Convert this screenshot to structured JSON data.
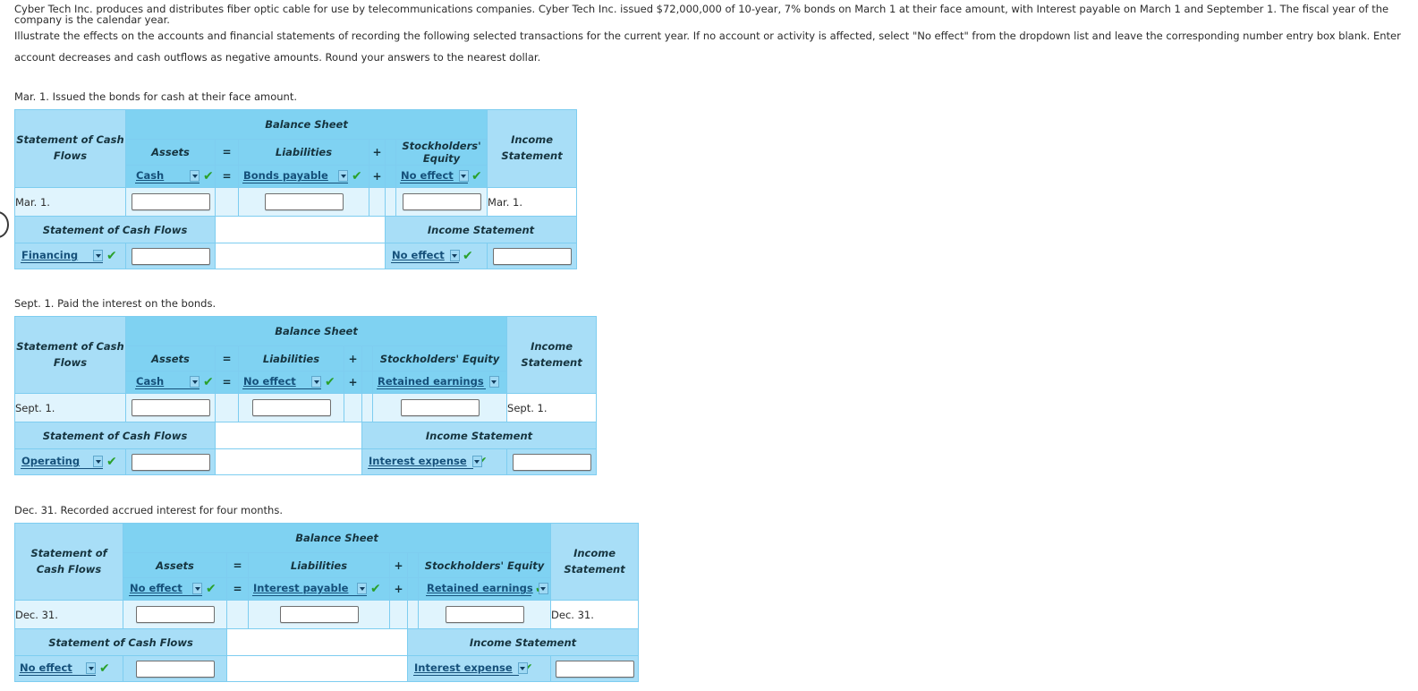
{
  "intro": {
    "paragraph1": "Cyber Tech Inc. produces and distributes fiber optic cable for use by telecommunications companies. Cyber Tech Inc. issued $72,000,000 of 10-year, 7% bonds on March 1 at their face amount, with Interest payable on March 1 and September 1. The fiscal year of the company is the calendar year.",
    "paragraph2": "Illustrate the effects on the accounts and financial statements of recording the following selected transactions for the current year. If no account or activity is affected, select \"No effect\" from the dropdown list and leave the corresponding number entry box blank. Enter account decreases and cash outflows as negative amounts. Round your answers to the nearest dollar."
  },
  "common": {
    "balance_sheet": "Balance Sheet",
    "scf_header": "Statement of Cash Flows",
    "assets": "Assets",
    "liabilities": "Liabilities",
    "stockholders_equity": "Stockholders' Equity",
    "income": "Income",
    "statement": "Statement",
    "income_statement": "Income Statement",
    "eq": "=",
    "plus": "+",
    "check_icon": "✔",
    "accent_blue": "#7fd2f2",
    "link_blue": "#15507a",
    "check_green": "#2aa02a"
  },
  "transactions": [
    {
      "label": "Mar. 1. Issued the bonds for cash at their face amount.",
      "date_left": "Mar. 1.",
      "date_right": "Mar. 1.",
      "assets_account": "Cash",
      "liabilities_account": "Bonds payable",
      "equity_account": "No effect",
      "scf_activity": "Financing",
      "is_account": "No effect",
      "assets_value": "",
      "liabilities_value": "",
      "equity_value": "",
      "scf_value": "",
      "is_value": ""
    },
    {
      "label": "Sept. 1. Paid the interest on the bonds.",
      "date_left": "Sept. 1.",
      "date_right": "Sept. 1.",
      "assets_account": "Cash",
      "liabilities_account": "No effect",
      "equity_account": "Retained earnings",
      "scf_activity": "Operating",
      "is_account": "Interest expense",
      "assets_value": "",
      "liabilities_value": "",
      "equity_value": "",
      "scf_value": "",
      "is_value": ""
    },
    {
      "label": "Dec. 31. Recorded accrued interest for four months.",
      "date_left": "Dec. 31.",
      "date_right": "Dec. 31.",
      "assets_account": "No effect",
      "liabilities_account": "Interest payable",
      "equity_account": "Retained earnings",
      "scf_activity": "No effect",
      "is_account": "Interest expense",
      "assets_value": "",
      "liabilities_value": "",
      "equity_value": "",
      "scf_value": "",
      "is_value": ""
    }
  ]
}
